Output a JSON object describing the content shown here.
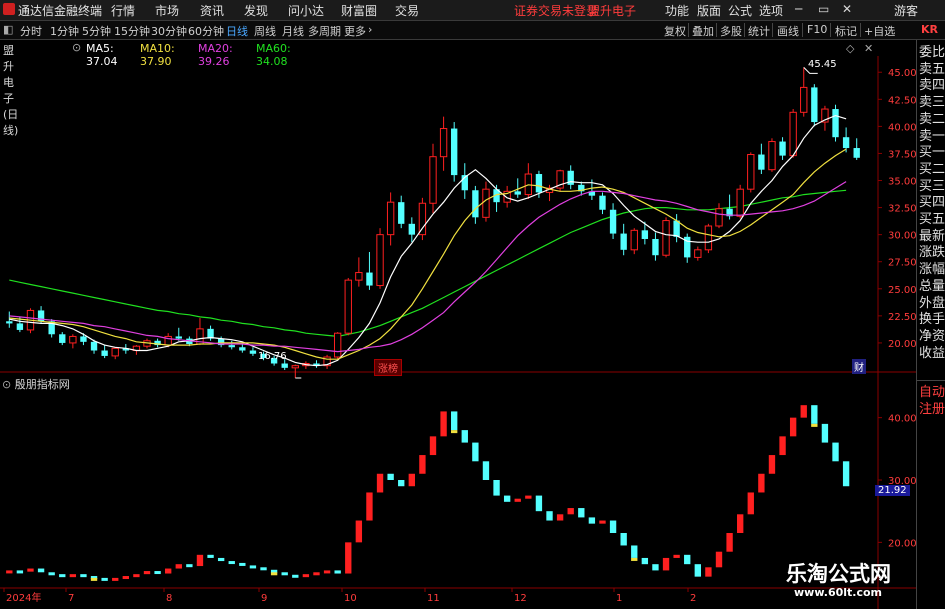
{
  "app": {
    "name": "通达信金融终端",
    "menu": [
      "行情",
      "市场",
      "资讯",
      "发现",
      "问小达",
      "财富圈",
      "交易"
    ],
    "notice": "证券交易未登录",
    "stock_title": "盟升电子",
    "right_menu": [
      "功能",
      "版面",
      "公式",
      "选项"
    ],
    "guest": "游客"
  },
  "toolbar": {
    "periods": [
      "分时",
      "1分钟",
      "5分钟",
      "15分钟",
      "30分钟",
      "60分钟",
      "日线",
      "周线",
      "月线",
      "多周期",
      "更多"
    ],
    "active_period": "日线",
    "right_buttons": [
      "复权",
      "叠加",
      "多股",
      "统计",
      "画线",
      "F10",
      "标记",
      "+自选"
    ],
    "kr_label": "KR"
  },
  "ma_legend": {
    "title": "盟升电子(日线)",
    "ma5": "MA5: 37.04",
    "ma10": "MA10: 37.90",
    "ma20": "MA20: 39.26",
    "ma60": "MA60: 34.08"
  },
  "colors": {
    "ma5": "#ffffff",
    "ma10": "#f0e040",
    "ma20": "#e040e0",
    "ma60": "#20e020",
    "up": "#ff2020",
    "down": "#54ffff",
    "axis": "#ff3c3c"
  },
  "side_panel": {
    "top_items": [
      "委比",
      "卖五",
      "卖四",
      "卖三",
      "卖二",
      "卖一",
      "买一",
      "买二",
      "买三",
      "买四",
      "买五",
      "最新",
      "涨跌",
      "涨幅",
      "总量",
      "外盘",
      "换手",
      "净资",
      "收益"
    ],
    "bottom_items": [
      "自动",
      "注册"
    ]
  },
  "chart_data": [
    {
      "type": "candlestick",
      "y_ticks": [
        "45.00",
        "42.50",
        "40.00",
        "37.50",
        "35.00",
        "32.50",
        "30.00",
        "27.50",
        "25.00",
        "22.50",
        "20.00"
      ],
      "ylim": [
        17.5,
        46.5
      ],
      "annotations": {
        "high": "45.45",
        "low": "16.76",
        "badge": "涨榜",
        "finance_badge": "财"
      },
      "ohlc": [
        [
          22.0,
          22.9,
          21.4,
          21.8
        ],
        [
          21.8,
          22.4,
          21.0,
          21.2
        ],
        [
          21.2,
          23.2,
          20.9,
          23.0
        ],
        [
          23.0,
          23.4,
          21.8,
          22.0
        ],
        [
          22.0,
          22.2,
          20.5,
          20.8
        ],
        [
          20.8,
          21.0,
          19.8,
          20.0
        ],
        [
          20.0,
          20.8,
          19.5,
          20.6
        ],
        [
          20.6,
          20.9,
          19.8,
          20.1
        ],
        [
          20.1,
          20.3,
          19.0,
          19.3
        ],
        [
          19.3,
          19.8,
          18.6,
          18.8
        ],
        [
          18.8,
          19.6,
          18.5,
          19.5
        ],
        [
          19.5,
          19.9,
          19.0,
          19.3
        ],
        [
          19.3,
          19.8,
          18.9,
          19.7
        ],
        [
          19.7,
          20.4,
          19.5,
          20.2
        ],
        [
          20.2,
          20.4,
          19.6,
          19.8
        ],
        [
          19.8,
          20.9,
          19.6,
          20.6
        ],
        [
          20.6,
          21.4,
          20.2,
          20.4
        ],
        [
          20.4,
          20.6,
          19.7,
          19.9
        ],
        [
          19.9,
          22.3,
          19.8,
          21.3
        ],
        [
          21.3,
          21.6,
          20.2,
          20.4
        ],
        [
          20.4,
          20.6,
          19.6,
          19.8
        ],
        [
          19.8,
          20.2,
          19.4,
          19.6
        ],
        [
          19.6,
          19.9,
          19.1,
          19.3
        ],
        [
          19.3,
          19.6,
          18.8,
          19.0
        ],
        [
          19.0,
          19.2,
          18.4,
          18.6
        ],
        [
          18.6,
          18.8,
          17.9,
          18.1
        ],
        [
          18.1,
          18.5,
          17.5,
          17.7
        ],
        [
          17.7,
          18.0,
          16.76,
          17.9
        ],
        [
          17.9,
          18.3,
          17.6,
          18.1
        ],
        [
          18.1,
          18.4,
          17.7,
          17.9
        ],
        [
          17.9,
          18.9,
          17.6,
          18.7
        ],
        [
          18.7,
          21.0,
          18.5,
          20.9
        ],
        [
          20.9,
          26.0,
          20.7,
          25.8
        ],
        [
          25.8,
          27.9,
          25.2,
          26.5
        ],
        [
          26.5,
          28.4,
          24.9,
          25.3
        ],
        [
          25.3,
          30.6,
          25.0,
          30.0
        ],
        [
          30.0,
          33.9,
          29.0,
          33.0
        ],
        [
          33.0,
          33.6,
          30.6,
          31.0
        ],
        [
          31.0,
          31.6,
          29.3,
          30.0
        ],
        [
          30.0,
          33.4,
          29.5,
          32.9
        ],
        [
          32.9,
          38.4,
          32.0,
          37.2
        ],
        [
          37.2,
          40.9,
          35.9,
          39.8
        ],
        [
          39.8,
          40.4,
          34.9,
          35.5
        ],
        [
          35.5,
          36.6,
          33.3,
          34.1
        ],
        [
          34.1,
          34.5,
          31.0,
          31.6
        ],
        [
          31.6,
          34.9,
          31.2,
          34.2
        ],
        [
          34.2,
          34.6,
          32.1,
          33.0
        ],
        [
          33.0,
          34.5,
          32.5,
          34.0
        ],
        [
          34.0,
          35.2,
          33.4,
          33.7
        ],
        [
          33.7,
          36.6,
          33.3,
          35.6
        ],
        [
          35.6,
          35.9,
          33.4,
          33.9
        ],
        [
          33.9,
          34.6,
          33.1,
          34.3
        ],
        [
          34.3,
          36.0,
          34.0,
          35.9
        ],
        [
          35.9,
          36.4,
          34.2,
          34.6
        ],
        [
          34.6,
          34.9,
          33.6,
          34.0
        ],
        [
          34.0,
          35.1,
          33.2,
          33.6
        ],
        [
          33.6,
          33.9,
          31.9,
          32.3
        ],
        [
          32.3,
          32.9,
          29.6,
          30.1
        ],
        [
          30.1,
          31.0,
          28.1,
          28.6
        ],
        [
          28.6,
          30.6,
          28.2,
          30.4
        ],
        [
          30.4,
          31.2,
          29.1,
          29.6
        ],
        [
          29.6,
          30.2,
          27.6,
          28.1
        ],
        [
          28.1,
          31.6,
          27.9,
          31.3
        ],
        [
          31.3,
          31.9,
          29.3,
          29.8
        ],
        [
          29.8,
          30.1,
          27.4,
          27.9
        ],
        [
          27.9,
          28.9,
          27.6,
          28.6
        ],
        [
          28.6,
          31.0,
          28.3,
          30.8
        ],
        [
          30.8,
          32.9,
          30.6,
          32.4
        ],
        [
          32.4,
          33.7,
          31.4,
          31.7
        ],
        [
          31.7,
          34.6,
          31.5,
          34.2
        ],
        [
          34.2,
          37.6,
          33.9,
          37.4
        ],
        [
          37.4,
          38.4,
          35.6,
          36.0
        ],
        [
          36.0,
          38.9,
          35.8,
          38.6
        ],
        [
          38.6,
          39.0,
          36.9,
          37.3
        ],
        [
          37.3,
          41.6,
          37.1,
          41.3
        ],
        [
          41.3,
          45.45,
          40.9,
          43.6
        ],
        [
          43.6,
          43.9,
          40.0,
          40.4
        ],
        [
          40.4,
          41.9,
          39.6,
          41.6
        ],
        [
          41.6,
          42.0,
          38.6,
          39.0
        ],
        [
          39.0,
          39.9,
          37.6,
          38.0
        ],
        [
          38.0,
          38.9,
          36.9,
          37.1
        ]
      ],
      "series": [
        {
          "name": "MA5",
          "values": [
            22.2,
            22.0,
            21.9,
            21.8,
            21.8,
            21.6,
            21.3,
            20.8,
            20.2,
            19.8,
            19.6,
            19.5,
            19.3,
            19.3,
            19.5,
            19.7,
            20.1,
            20.2,
            20.4,
            20.5,
            20.4,
            20.3,
            20.1,
            19.7,
            19.3,
            18.9,
            18.6,
            18.2,
            18.0,
            17.9,
            18.0,
            18.4,
            19.4,
            20.5,
            21.8,
            23.7,
            26.1,
            28.0,
            29.2,
            30.6,
            31.9,
            33.0,
            34.3,
            35.3,
            36.0,
            35.2,
            34.2,
            33.4,
            33.1,
            33.4,
            33.8,
            34.2,
            34.6,
            34.9,
            34.8,
            34.8,
            34.6,
            33.8,
            32.7,
            31.7,
            31.0,
            30.3,
            30.0,
            29.9,
            29.4,
            29.3,
            29.3,
            29.6,
            30.3,
            31.3,
            32.9,
            34.0,
            35.0,
            36.3,
            37.3,
            38.9,
            40.1,
            40.6,
            41.0,
            40.7
          ],
          "color_key": "ma5"
        },
        {
          "name": "MA10",
          "values": [
            22.3,
            22.2,
            22.1,
            22.0,
            21.9,
            21.8,
            21.7,
            21.5,
            21.2,
            20.9,
            20.6,
            20.4,
            20.1,
            20.0,
            19.9,
            19.8,
            19.8,
            19.8,
            19.9,
            19.9,
            20.0,
            20.0,
            20.0,
            20.0,
            19.9,
            19.8,
            19.6,
            19.3,
            19.0,
            18.7,
            18.5,
            18.5,
            18.9,
            19.3,
            19.8,
            20.4,
            21.3,
            22.4,
            23.5,
            25.0,
            26.6,
            28.2,
            29.9,
            31.3,
            32.4,
            33.2,
            33.7,
            33.8,
            34.2,
            34.6,
            34.5,
            34.2,
            34.0,
            34.0,
            34.1,
            34.3,
            34.4,
            34.2,
            33.9,
            33.4,
            32.9,
            32.4,
            31.9,
            31.3,
            30.6,
            30.2,
            30.0,
            29.8,
            29.9,
            30.3,
            30.9,
            31.6,
            32.3,
            33.0,
            33.7,
            34.8,
            35.8,
            36.6,
            37.3,
            37.9
          ],
          "color_key": "ma10"
        },
        {
          "name": "MA20",
          "values": [
            22.5,
            22.4,
            22.3,
            22.2,
            22.1,
            22.0,
            21.9,
            21.8,
            21.6,
            21.5,
            21.3,
            21.1,
            20.9,
            20.7,
            20.6,
            20.4,
            20.3,
            20.2,
            20.1,
            20.0,
            19.9,
            19.9,
            19.9,
            19.8,
            19.8,
            19.7,
            19.7,
            19.6,
            19.5,
            19.4,
            19.3,
            19.2,
            19.3,
            19.4,
            19.6,
            19.7,
            19.9,
            20.3,
            20.8,
            21.4,
            22.1,
            22.8,
            23.8,
            24.7,
            25.6,
            26.6,
            27.7,
            28.8,
            29.9,
            30.8,
            31.6,
            32.2,
            32.8,
            33.3,
            33.7,
            34.0,
            34.0,
            33.9,
            33.8,
            33.6,
            33.4,
            33.2,
            33.1,
            32.9,
            32.6,
            32.3,
            32.1,
            31.9,
            31.8,
            31.8,
            31.9,
            32.0,
            32.1,
            32.2,
            32.4,
            32.7,
            33.1,
            33.7,
            34.3,
            34.9
          ],
          "color_key": "ma20"
        },
        {
          "name": "MA60",
          "values": [
            25.8,
            25.6,
            25.4,
            25.2,
            25.0,
            24.8,
            24.6,
            24.4,
            24.2,
            24.0,
            23.8,
            23.6,
            23.4,
            23.2,
            23.0,
            22.9,
            22.7,
            22.6,
            22.4,
            22.3,
            22.1,
            22.0,
            21.8,
            21.7,
            21.5,
            21.4,
            21.2,
            21.1,
            20.9,
            20.8,
            20.7,
            20.6,
            20.8,
            21.0,
            21.3,
            21.6,
            22.0,
            22.4,
            22.8,
            23.2,
            23.7,
            24.2,
            24.7,
            25.2,
            25.7,
            26.2,
            26.7,
            27.2,
            27.7,
            28.2,
            28.7,
            29.2,
            29.7,
            30.2,
            30.6,
            31.0,
            31.4,
            31.7,
            32.0,
            32.2,
            32.4,
            32.5,
            32.5,
            32.4,
            32.3,
            32.3,
            32.3,
            32.4,
            32.5,
            32.6,
            32.8,
            33.0,
            33.2,
            33.4,
            33.5,
            33.7,
            33.8,
            33.9,
            34.0,
            34.1
          ],
          "color_key": "ma60"
        }
      ]
    },
    {
      "type": "bar",
      "title": "殷朋指标网",
      "y_ticks": [
        "40.00",
        "30.00",
        "20.00"
      ],
      "ylim": [
        13,
        47
      ],
      "last_value": "21.92",
      "x_labels": [
        "2024年",
        "7",
        "8",
        "9",
        "10",
        "11",
        "12",
        "1",
        "2"
      ],
      "values": [
        15.5,
        15.3,
        15.8,
        15.2,
        14.9,
        14.5,
        14.9,
        14.6,
        14.3,
        14.0,
        14.3,
        14.6,
        14.9,
        15.4,
        15.0,
        15.8,
        16.5,
        16.2,
        18.0,
        17.5,
        17.0,
        16.7,
        16.3,
        16.0,
        15.6,
        15.2,
        14.8,
        14.5,
        14.9,
        15.2,
        15.5,
        15.0,
        20.0,
        23.5,
        28.0,
        31.0,
        30.0,
        29.0,
        31.0,
        34.0,
        37.0,
        41.0,
        38.0,
        36.0,
        33.0,
        30.0,
        27.5,
        26.5,
        27.0,
        27.5,
        25.0,
        23.5,
        24.5,
        25.5,
        24.0,
        23.0,
        23.5,
        21.5,
        19.5,
        17.5,
        16.5,
        15.5,
        17.5,
        18.0,
        16.5,
        14.5,
        16.0,
        18.5,
        21.5,
        24.5,
        28.0,
        31.0,
        34.0,
        37.0,
        40.0,
        42.0,
        39.0,
        36.0,
        33.0,
        29.0
      ]
    }
  ],
  "watermark": {
    "text": "乐淘公式网",
    "url": "www.60lt.com"
  }
}
